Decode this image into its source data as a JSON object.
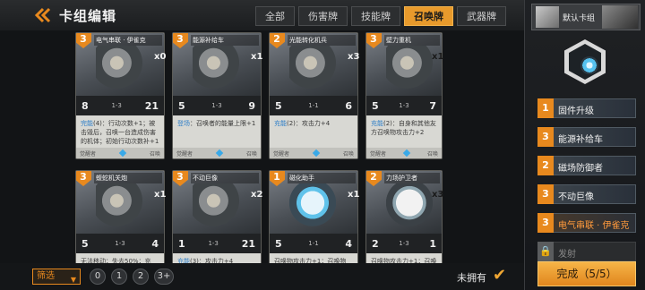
{
  "header": {
    "title": "卡组编辑"
  },
  "tabs": [
    {
      "label": "全部",
      "active": false
    },
    {
      "label": "伤害牌",
      "active": false
    },
    {
      "label": "技能牌",
      "active": false
    },
    {
      "label": "召唤牌",
      "active": true
    },
    {
      "label": "武器牌",
      "active": false
    }
  ],
  "cards": [
    {
      "cost": "3",
      "name": "电气串联 · 伊雀克",
      "count": "x0",
      "atk": "8",
      "range": "1-3",
      "hp": "21",
      "desc_kw": "完能",
      "desc": "(4)：行动次数+1；被击毁后，召唤一台造成伤害的机体；初始行动次数补+1",
      "footer_left": "觉醒者",
      "footer_right": "召唤"
    },
    {
      "cost": "3",
      "name": "能源补给车",
      "count": "x1",
      "atk": "5",
      "range": "1-3",
      "hp": "9",
      "desc_kw": "登场",
      "desc": "：召唤者的能量上限+1",
      "footer_left": "觉醒者",
      "footer_right": "召唤"
    },
    {
      "cost": "2",
      "name": "光能转化机兵",
      "count": "x3",
      "atk": "5",
      "range": "1-1",
      "hp": "6",
      "desc_kw": "充能",
      "desc": "(2)：攻击力+4",
      "footer_left": "觉醒者",
      "footer_right": "召唤"
    },
    {
      "cost": "3",
      "name": "壁力重机",
      "count": "x1",
      "atk": "5",
      "range": "1-3",
      "hp": "7",
      "desc_kw": "充能",
      "desc": "(2)：自身和其他友方召唤物攻击力+2",
      "footer_left": "觉醒者",
      "footer_right": "召唤"
    },
    {
      "cost": "3",
      "name": "蝮蛇机关炮",
      "count": "x1",
      "atk": "5",
      "range": "1-3",
      "hp": "4",
      "desc_kw": "",
      "desc": "无法移动；失去50%；充",
      "footer_left": "",
      "footer_right": ""
    },
    {
      "cost": "3",
      "name": "不动巨像",
      "count": "x2",
      "atk": "1",
      "range": "1-3",
      "hp": "21",
      "desc_kw": "充能",
      "desc": "(3)：攻击力+4",
      "footer_left": "",
      "footer_right": ""
    },
    {
      "cost": "1",
      "name": "磁化助手",
      "count": "x1",
      "atk": "5",
      "range": "1-1",
      "hp": "4",
      "desc_kw": "",
      "desc": "召唤物攻击力+1；召唤物",
      "footer_left": "",
      "footer_right": ""
    },
    {
      "cost": "2",
      "name": "力场护卫者",
      "count": "x3",
      "atk": "2",
      "range": "1-3",
      "hp": "1",
      "desc_kw": "",
      "desc": "召唤物攻击力+1；召唤物",
      "footer_left": "",
      "footer_right": ""
    }
  ],
  "sidebar": {
    "deck_name": "默认卡组",
    "items": [
      {
        "cost": "1",
        "name": "固件升级",
        "locked": false,
        "highlight": false
      },
      {
        "cost": "3",
        "name": "能源补给车",
        "locked": false,
        "highlight": false
      },
      {
        "cost": "2",
        "name": "磁场防御者",
        "locked": false,
        "highlight": false
      },
      {
        "cost": "3",
        "name": "不动巨像",
        "locked": false,
        "highlight": false
      },
      {
        "cost": "3",
        "name": "电气串联 · 伊雀克",
        "locked": false,
        "highlight": true
      },
      {
        "cost": "",
        "name": "发射",
        "locked": true,
        "highlight": false
      }
    ],
    "done_label": "完成（5/5）"
  },
  "bottom": {
    "filter_label": "筛选",
    "cost_filters": [
      "0",
      "1",
      "2",
      "3+"
    ],
    "unowned_label": "未拥有",
    "unowned_checked": true
  },
  "colors": {
    "accent": "#e8891e",
    "active_tab": "#e89a2c",
    "keyword": "#2f7fc8"
  }
}
